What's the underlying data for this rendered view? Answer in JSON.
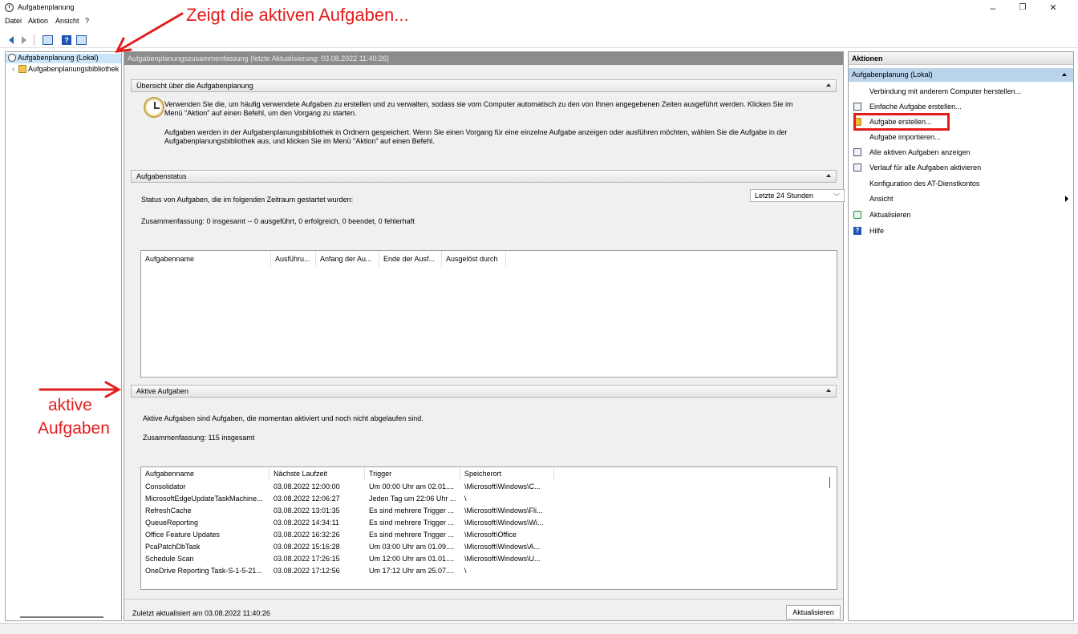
{
  "window": {
    "title": "Aufgabenplanung",
    "minimize": "–",
    "maximize": "❐",
    "close": "✕"
  },
  "menu": [
    "Datei",
    "Aktion",
    "Ansicht",
    "?"
  ],
  "tree": {
    "root": "Aufgabenplanung (Lokal)",
    "library": "Aufgabenplanungsbibliothek"
  },
  "center": {
    "header": "Aufgabenplanungszusammenfassung (letzte Aktualisierung: 03.08.2022 11:40:26)",
    "overview": {
      "title": "Übersicht über die Aufgabenplanung",
      "para1_line1": "Verwenden Sie die, um häufig verwendete Aufgaben zu erstellen und zu verwalten, sodass sie vom Computer automatisch zu den von Ihnen angegebenen Zeiten ausgeführt werden. Klicken Sie im",
      "para1_line2": "Menü \"Aktion\" auf einen Befehl, um den Vorgang zu starten.",
      "para2_line1": "Aufgaben werden in der Aufgabenplanungsbibliothek in Ordnern gespeichert. Wenn Sie einen Vorgang für eine einzelne Aufgabe anzeigen oder ausführen möchten, wählen Sie die Aufgabe in der",
      "para2_line2": "Aufgabenplanungsbibliothek aus, und klicken Sie im Menü \"Aktion\" auf einen Befehl."
    },
    "status": {
      "title": "Aufgabenstatus",
      "label": "Status von Aufgaben, die im folgenden Zeitraum gestartet wurden:",
      "timeframe": "Letzte 24 Stunden",
      "summary": "Zusammenfassung: 0 insgesamt -- 0 ausgeführt, 0 erfolgreich, 0 beendet, 0 fehlerhaft",
      "columns": [
        "Aufgabenname",
        "Ausführu...",
        "Anfang der Au...",
        "Ende der Ausf...",
        "Ausgelöst durch"
      ]
    },
    "active": {
      "title": "Aktive Aufgaben",
      "description": "Aktive Aufgaben sind Aufgaben, die momentan aktiviert und noch nicht abgelaufen sind.",
      "summary": "Zusammenfassung: 115 insgesamt",
      "columns": [
        "Aufgabenname",
        "Nächste Laufzeit",
        "Trigger",
        "Speicherort"
      ],
      "rows": [
        [
          "Consolidator",
          "03.08.2022 12:00:00",
          "Um 00:00 Uhr am 02.01....",
          "\\Microsoft\\Windows\\C..."
        ],
        [
          "MicrosoftEdgeUpdateTaskMachine...",
          "03.08.2022 12:06:27",
          "Jeden Tag um 22:06 Uhr ...",
          "\\"
        ],
        [
          "RefreshCache",
          "03.08.2022 13:01:35",
          "Es sind mehrere Trigger ...",
          "\\Microsoft\\Windows\\Fli..."
        ],
        [
          "QueueReporting",
          "03.08.2022 14:34:11",
          "Es sind mehrere Trigger ...",
          "\\Microsoft\\Windows\\Wi..."
        ],
        [
          "Office Feature Updates",
          "03.08.2022 16:32:26",
          "Es sind mehrere Trigger ...",
          "\\Microsoft\\Office"
        ],
        [
          "PcaPatchDbTask",
          "03.08.2022 15:16:28",
          "Um 03:00 Uhr am 01.09....",
          "\\Microsoft\\Windows\\A..."
        ],
        [
          "Schedule Scan",
          "03.08.2022 17:26:15",
          "Um 12:00 Uhr am 01.01....",
          "\\Microsoft\\Windows\\U..."
        ],
        [
          "OneDrive Reporting Task-S-1-5-21...",
          "03.08.2022 17:12:56",
          "Um 17:12 Uhr am 25.07....",
          "\\"
        ]
      ]
    },
    "footer": {
      "last_updated": "Zuletzt aktualisiert am 03.08.2022 11:40:26",
      "refresh": "Aktualisieren"
    }
  },
  "actions": {
    "title": "Aktionen",
    "group": "Aufgabenplanung (Lokal)",
    "items": [
      {
        "label": "Verbindung mit anderem Computer herstellen...",
        "icon": ""
      },
      {
        "label": "Einfache Aufgabe erstellen...",
        "icon": "calendar-icon"
      },
      {
        "label": "Aufgabe erstellen...",
        "icon": "task-icon"
      },
      {
        "label": "Aufgabe importieren...",
        "icon": ""
      },
      {
        "label": "Alle aktiven Aufgaben anzeigen",
        "icon": "list-icon"
      },
      {
        "label": "Verlauf für alle Aufgaben aktivieren",
        "icon": "history-icon"
      },
      {
        "label": "Konfiguration des AT-Dienstkontos",
        "icon": ""
      },
      {
        "label": "Ansicht",
        "icon": ""
      },
      {
        "label": "Aktualisieren",
        "icon": "refresh-icon"
      },
      {
        "label": "Hilfe",
        "icon": "help-icon"
      }
    ]
  },
  "annotations": {
    "top": "Zeigt die aktiven Aufgaben...",
    "left_line1": "aktive",
    "left_line2": "Aufgaben",
    "color": "#e21d1d"
  }
}
